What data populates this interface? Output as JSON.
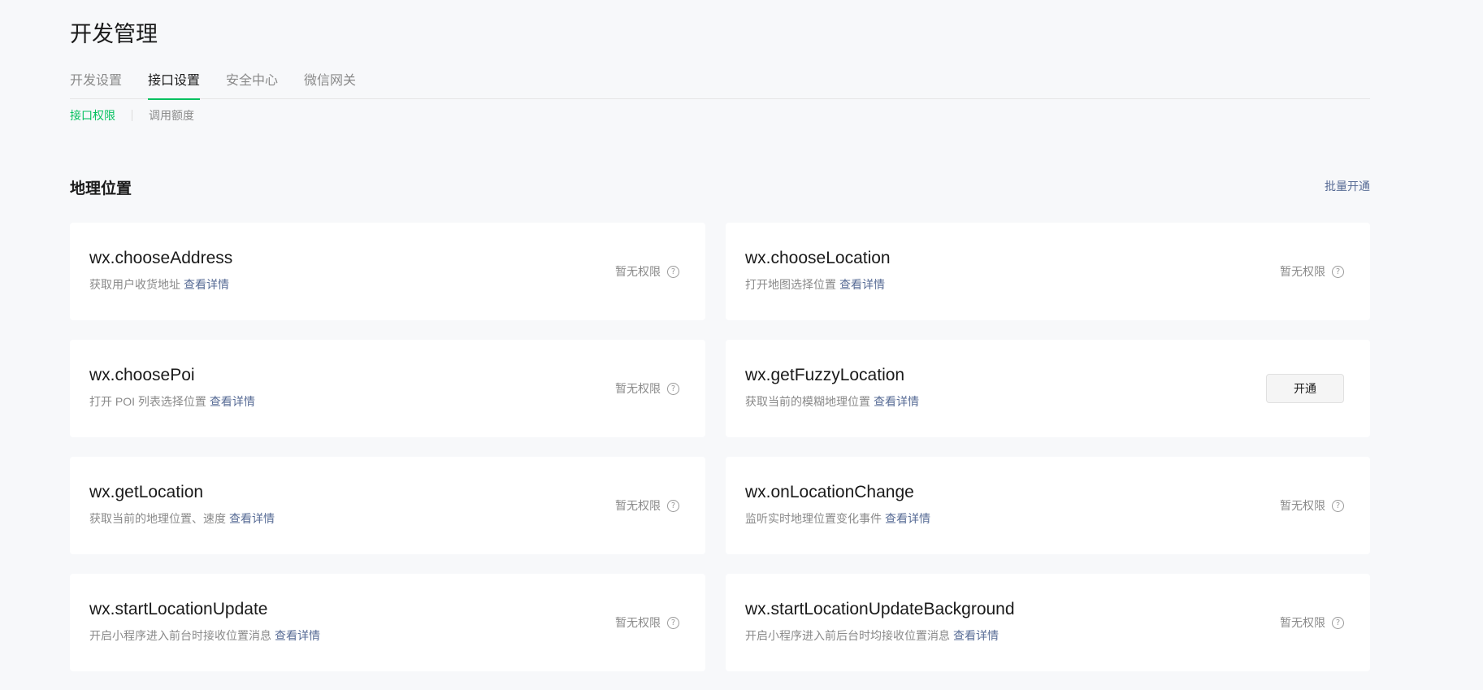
{
  "header": {
    "title": "开发管理"
  },
  "tabs": [
    {
      "label": "开发设置",
      "active": false
    },
    {
      "label": "接口设置",
      "active": true
    },
    {
      "label": "安全中心",
      "active": false
    },
    {
      "label": "微信网关",
      "active": false
    }
  ],
  "subtabs": [
    {
      "label": "接口权限",
      "active": true
    },
    {
      "label": "调用额度",
      "active": false
    }
  ],
  "section": {
    "title": "地理位置",
    "batch_label": "批量开通"
  },
  "apis": [
    {
      "name": "wx.chooseAddress",
      "desc": "获取用户收货地址",
      "link": "查看详情",
      "status": "暂无权限"
    },
    {
      "name": "wx.chooseLocation",
      "desc": "打开地图选择位置",
      "link": "查看详情",
      "status": "暂无权限"
    },
    {
      "name": "wx.choosePoi",
      "desc": "打开 POI 列表选择位置",
      "link": "查看详情",
      "status": "暂无权限"
    },
    {
      "name": "wx.getFuzzyLocation",
      "desc": "获取当前的模糊地理位置",
      "link": "查看详情",
      "button": "开通"
    },
    {
      "name": "wx.getLocation",
      "desc": "获取当前的地理位置、速度",
      "link": "查看详情",
      "status": "暂无权限"
    },
    {
      "name": "wx.onLocationChange",
      "desc": "监听实时地理位置变化事件",
      "link": "查看详情",
      "status": "暂无权限"
    },
    {
      "name": "wx.startLocationUpdate",
      "desc": "开启小程序进入前台时接收位置消息",
      "link": "查看详情",
      "status": "暂无权限"
    },
    {
      "name": "wx.startLocationUpdateBackground",
      "desc": "开启小程序进入前后台时均接收位置消息",
      "link": "查看详情",
      "status": "暂无权限"
    }
  ],
  "icons": {
    "help": "question-circle-icon",
    "help_glyph": "?"
  },
  "colors": {
    "accent": "#07c160",
    "link": "#576b95",
    "background": "#f7f8fa",
    "muted_text": "#8a8a8a"
  }
}
